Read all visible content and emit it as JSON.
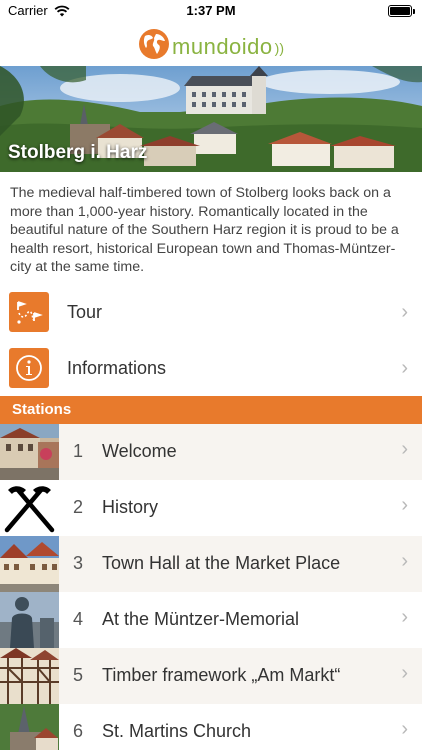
{
  "status_bar": {
    "carrier": "Carrier",
    "time": "1:37 PM"
  },
  "app": {
    "logo_text": "mundoido",
    "logo_waves": "))"
  },
  "hero": {
    "title": "Stolberg i. Harz"
  },
  "description": "The medieval half-timbered town of Stolberg looks back on a more than 1,000-year history. Romantically located in the beautiful nature of the Southern Harz region it is proud to be a health resort, historical European town and Thomas-Müntzer-city at the same time.",
  "menu": [
    {
      "label": "Tour",
      "icon": "tour-map-icon"
    },
    {
      "label": "Informations",
      "icon": "info-icon"
    }
  ],
  "section": {
    "title": "Stations"
  },
  "stations": [
    {
      "number": "1",
      "title": "Welcome",
      "thumb": "town-street-photo"
    },
    {
      "number": "2",
      "title": "History",
      "thumb": "hammer-pick-icon"
    },
    {
      "number": "3",
      "title": "Town Hall at the Market Place",
      "thumb": "town-hall-photo"
    },
    {
      "number": "4",
      "title": "At the Müntzer-Memorial",
      "thumb": "statue-photo"
    },
    {
      "number": "5",
      "title": "Timber framework „Am Markt“",
      "thumb": "timber-houses-photo"
    },
    {
      "number": "6",
      "title": "St. Martins Church",
      "thumb": "church-photo"
    }
  ],
  "colors": {
    "accent": "#e87a2c",
    "logo_green": "#8ab341",
    "row_alt": "#f7f4f0"
  }
}
